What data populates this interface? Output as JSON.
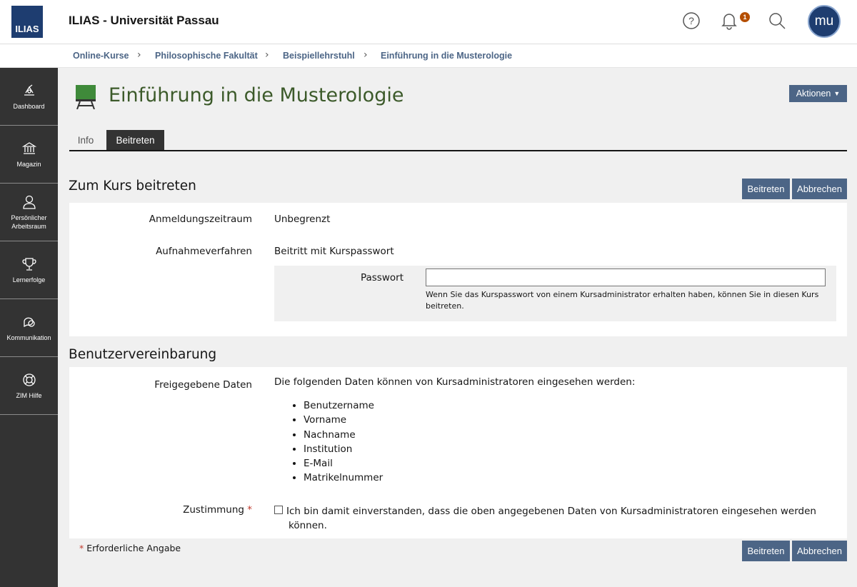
{
  "header": {
    "logo": "ILIAS",
    "title": "ILIAS - Universität Passau",
    "notification_count": "1",
    "avatar_initials": "mu"
  },
  "breadcrumb": [
    "Online-Kurse",
    "Philosophische Fakultät",
    "Beispiellehrstuhl",
    "Einführung in die Musterologie"
  ],
  "sidebar": {
    "items": [
      {
        "label": "Dashboard",
        "icon": "dashboard-icon"
      },
      {
        "label": "Magazin",
        "icon": "bank-icon"
      },
      {
        "label": "Persönlicher Arbeitsraum",
        "icon": "person-icon"
      },
      {
        "label": "Lernerfolge",
        "icon": "trophy-icon"
      },
      {
        "label": "Kommunikation",
        "icon": "chat-icon"
      },
      {
        "label": "ZIM Hilfe",
        "icon": "lifebuoy-icon"
      }
    ]
  },
  "page": {
    "title": "Einführung in die Musterologie",
    "actions_label": "Aktionen"
  },
  "tabs": [
    "Info",
    "Beitreten"
  ],
  "join_section": {
    "title": "Zum Kurs beitreten",
    "join_button": "Beitreten",
    "cancel_button": "Abbrechen",
    "registration_period_label": "Anmeldungszeitraum",
    "registration_period_value": "Unbegrenzt",
    "admission_label": "Aufnahmeverfahren",
    "admission_value": "Beitritt mit Kurspasswort",
    "password_label": "Passwort",
    "password_value": "",
    "password_help": "Wenn Sie das Kurspasswort von einem Kursadministrator erhalten haben, können Sie in diesen Kurs beitreten."
  },
  "agreement_section": {
    "title": "Benutzervereinbarung",
    "shared_data_label": "Freigegebene Daten",
    "shared_data_intro": "Die folgenden Daten können von Kursadministratoren eingesehen werden:",
    "shared_data_items": [
      "Benutzername",
      "Vorname",
      "Nachname",
      "Institution",
      "E-Mail",
      "Matrikelnummer"
    ],
    "consent_label": "Zustimmung",
    "consent_required_marker": "*",
    "consent_text_line1": "Ich bin damit einverstanden, dass die oben angegebenen Daten von Kursadministratoren eingesehen werden",
    "consent_text_line2": "können.",
    "consent_checked": false
  },
  "footer": {
    "required_marker": "*",
    "required_note": "Erforderliche Angabe",
    "join_button": "Beitreten",
    "cancel_button": "Abbrechen"
  },
  "colors": {
    "primary": "#4c6586",
    "brand": "#1e3d70",
    "sidebar": "#333333",
    "title_green": "#3c5a2a",
    "badge": "#b54f00"
  }
}
